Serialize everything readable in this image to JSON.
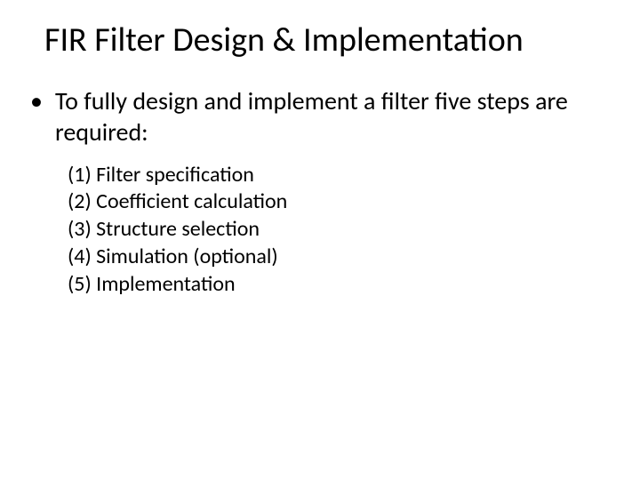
{
  "title": "FIR Filter Design & Implementation",
  "bullet": {
    "marker": "•",
    "text": "To fully design and implement a filter five steps are required:"
  },
  "steps": [
    "(1) Filter specification",
    "(2) Coefficient calculation",
    "(3) Structure selection",
    "(4) Simulation (optional)",
    "(5) Implementation"
  ]
}
